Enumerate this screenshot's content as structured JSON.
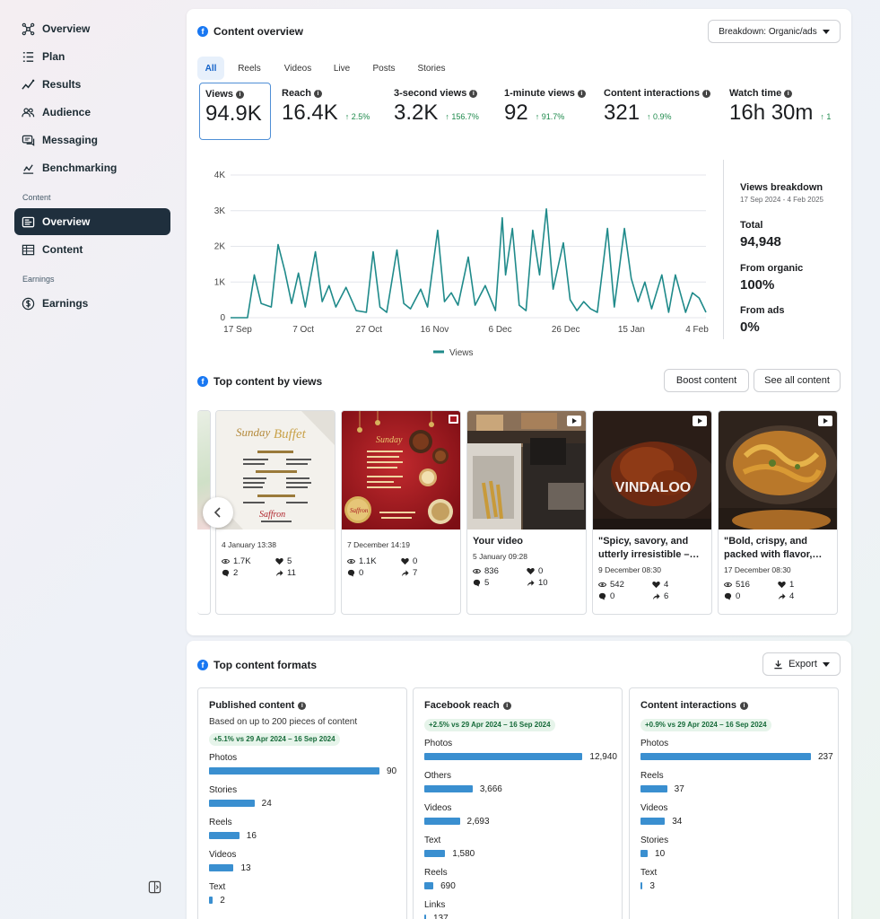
{
  "sidebar": {
    "items": [
      {
        "label": "Overview",
        "icon": "nodes-icon"
      },
      {
        "label": "Plan",
        "icon": "list-icon"
      },
      {
        "label": "Results",
        "icon": "trend-icon"
      },
      {
        "label": "Audience",
        "icon": "people-icon"
      },
      {
        "label": "Messaging",
        "icon": "chat-icon"
      },
      {
        "label": "Benchmarking",
        "icon": "benchmark-icon"
      }
    ],
    "content_section_label": "Content",
    "content_items": [
      {
        "label": "Overview",
        "active": true
      },
      {
        "label": "Content",
        "active": false
      }
    ],
    "earnings_section_label": "Earnings",
    "earnings_items": [
      {
        "label": "Earnings"
      }
    ]
  },
  "content_overview": {
    "title": "Content overview",
    "breakdown_button": "Breakdown: Organic/ads",
    "tabs": [
      "All",
      "Reels",
      "Videos",
      "Live",
      "Posts",
      "Stories"
    ],
    "active_tab": "All",
    "metrics": [
      {
        "label": "Views",
        "value": "94.9K",
        "delta": ""
      },
      {
        "label": "Reach",
        "value": "16.4K",
        "delta": "↑ 2.5%"
      },
      {
        "label": "3-second views",
        "value": "3.2K",
        "delta": "↑ 156.7%"
      },
      {
        "label": "1-minute views",
        "value": "92",
        "delta": "↑ 91.7%"
      },
      {
        "label": "Content interactions",
        "value": "321",
        "delta": "↑ 0.9%"
      },
      {
        "label": "Watch time",
        "value": "16h 30m",
        "delta": "↑ 1"
      }
    ],
    "legend": "Views",
    "breakdown": {
      "title": "Views breakdown",
      "date_range": "17 Sep 2024 - 4 Feb 2025",
      "total_label": "Total",
      "total_value": "94,948",
      "organic_label": "From organic",
      "organic_value": "100%",
      "ads_label": "From ads",
      "ads_value": "0%"
    }
  },
  "chart_data": {
    "type": "line",
    "series": [
      {
        "name": "Views",
        "color": "#1f8a8a"
      }
    ],
    "y_ticks": [
      "0",
      "1K",
      "2K",
      "3K",
      "4K"
    ],
    "ylim": [
      0,
      4000
    ],
    "x_ticks": [
      "17 Sep",
      "7 Oct",
      "27 Oct",
      "16 Nov",
      "6 Dec",
      "26 Dec",
      "15 Jan",
      "4 Feb"
    ],
    "x_start": "2024-09-17",
    "x_end": "2025-02-04",
    "points": [
      [
        "2024-09-17",
        0
      ],
      [
        "2024-09-22",
        0
      ],
      [
        "2024-09-24",
        1200
      ],
      [
        "2024-09-26",
        400
      ],
      [
        "2024-09-29",
        300
      ],
      [
        "2024-10-01",
        2050
      ],
      [
        "2024-10-03",
        1300
      ],
      [
        "2024-10-05",
        400
      ],
      [
        "2024-10-07",
        1250
      ],
      [
        "2024-10-09",
        300
      ],
      [
        "2024-10-12",
        1850
      ],
      [
        "2024-10-14",
        450
      ],
      [
        "2024-10-16",
        900
      ],
      [
        "2024-10-18",
        300
      ],
      [
        "2024-10-21",
        850
      ],
      [
        "2024-10-24",
        200
      ],
      [
        "2024-10-27",
        150
      ],
      [
        "2024-10-29",
        1850
      ],
      [
        "2024-10-31",
        300
      ],
      [
        "2024-11-02",
        150
      ],
      [
        "2024-11-05",
        1900
      ],
      [
        "2024-11-07",
        400
      ],
      [
        "2024-11-09",
        250
      ],
      [
        "2024-11-12",
        800
      ],
      [
        "2024-11-14",
        300
      ],
      [
        "2024-11-17",
        2450
      ],
      [
        "2024-11-19",
        450
      ],
      [
        "2024-11-21",
        700
      ],
      [
        "2024-11-23",
        350
      ],
      [
        "2024-11-26",
        1700
      ],
      [
        "2024-11-28",
        350
      ],
      [
        "2024-12-01",
        900
      ],
      [
        "2024-12-04",
        200
      ],
      [
        "2024-12-06",
        2800
      ],
      [
        "2024-12-07",
        1200
      ],
      [
        "2024-12-09",
        2500
      ],
      [
        "2024-12-11",
        350
      ],
      [
        "2024-12-13",
        200
      ],
      [
        "2024-12-15",
        2450
      ],
      [
        "2024-12-17",
        1200
      ],
      [
        "2024-12-19",
        3050
      ],
      [
        "2024-12-21",
        800
      ],
      [
        "2024-12-24",
        2100
      ],
      [
        "2024-12-26",
        500
      ],
      [
        "2024-12-28",
        200
      ],
      [
        "2024-12-30",
        450
      ],
      [
        "2025-01-01",
        250
      ],
      [
        "2025-01-03",
        150
      ],
      [
        "2025-01-06",
        2500
      ],
      [
        "2025-01-08",
        300
      ],
      [
        "2025-01-11",
        2500
      ],
      [
        "2025-01-13",
        1100
      ],
      [
        "2025-01-15",
        450
      ],
      [
        "2025-01-17",
        1000
      ],
      [
        "2025-01-19",
        250
      ],
      [
        "2025-01-22",
        1200
      ],
      [
        "2025-01-24",
        150
      ],
      [
        "2025-01-26",
        1200
      ],
      [
        "2025-01-29",
        150
      ],
      [
        "2025-01-31",
        700
      ],
      [
        "2025-02-02",
        550
      ],
      [
        "2025-02-04",
        150
      ]
    ]
  },
  "top_content": {
    "title": "Top content by views",
    "boost_button": "Boost content",
    "see_all_button": "See all content",
    "posts": [
      {
        "title": "",
        "date": "4 January 13:38",
        "views": "1.7K",
        "likes": "5",
        "comments": "2",
        "shares": "11",
        "type": "photo"
      },
      {
        "title": "",
        "date": "7 December 14:19",
        "views": "1.1K",
        "likes": "0",
        "comments": "0",
        "shares": "7",
        "type": "photo"
      },
      {
        "title": "Your video",
        "date": "5 January 09:28",
        "views": "836",
        "likes": "0",
        "comments": "5",
        "shares": "10",
        "type": "video"
      },
      {
        "title": "\"Spicy, savory, and utterly irresistible –…",
        "date": "9 December 08:30",
        "views": "542",
        "likes": "4",
        "comments": "0",
        "shares": "6",
        "type": "video",
        "overlay": "VINDALOO"
      },
      {
        "title": "\"Bold, crispy, and packed with flavor,…",
        "date": "17 December 08:30",
        "views": "516",
        "likes": "1",
        "comments": "0",
        "shares": "4",
        "type": "video"
      }
    ]
  },
  "formats": {
    "title": "Top content formats",
    "export_button": "Export",
    "cards": [
      {
        "title": "Published content",
        "subtitle": "Based on up to 200 pieces of content",
        "badge": "+5.1% vs 29 Apr 2024 – 16 Sep 2024",
        "max": 90,
        "rows": [
          {
            "label": "Photos",
            "value": 90,
            "display": "90"
          },
          {
            "label": "Stories",
            "value": 24,
            "display": "24"
          },
          {
            "label": "Reels",
            "value": 16,
            "display": "16"
          },
          {
            "label": "Videos",
            "value": 13,
            "display": "13"
          },
          {
            "label": "Text",
            "value": 2,
            "display": "2"
          }
        ]
      },
      {
        "title": "Facebook reach",
        "subtitle": "",
        "badge": "+2.5% vs 29 Apr 2024 – 16 Sep 2024",
        "max": 12940,
        "rows": [
          {
            "label": "Photos",
            "value": 12940,
            "display": "12,940"
          },
          {
            "label": "Others",
            "value": 3666,
            "display": "3,666"
          },
          {
            "label": "Videos",
            "value": 2693,
            "display": "2,693"
          },
          {
            "label": "Text",
            "value": 1580,
            "display": "1,580"
          },
          {
            "label": "Reels",
            "value": 690,
            "display": "690"
          },
          {
            "label": "Links",
            "value": 137,
            "display": "137"
          }
        ]
      },
      {
        "title": "Content interactions",
        "subtitle": "",
        "badge": "+0.9% vs 29 Apr 2024 – 16 Sep 2024",
        "max": 237,
        "rows": [
          {
            "label": "Photos",
            "value": 237,
            "display": "237"
          },
          {
            "label": "Reels",
            "value": 37,
            "display": "37"
          },
          {
            "label": "Videos",
            "value": 34,
            "display": "34"
          },
          {
            "label": "Stories",
            "value": 10,
            "display": "10"
          },
          {
            "label": "Text",
            "value": 3,
            "display": "3"
          }
        ]
      }
    ]
  }
}
